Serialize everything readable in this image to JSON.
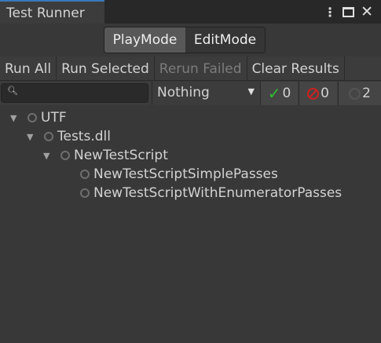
{
  "window": {
    "tab_title": "Test Runner",
    "menu_icon": "kebab-menu-icon",
    "maximize_icon": "maximize-icon",
    "close_icon": "close-icon"
  },
  "modes": {
    "play": "PlayMode",
    "edit": "EditMode",
    "selected": "PlayMode"
  },
  "toolbar": {
    "run_all": "Run All",
    "run_selected": "Run Selected",
    "rerun_failed": "Rerun Failed",
    "clear_results": "Clear Results"
  },
  "filter": {
    "search_value": "",
    "category": "Nothing",
    "passed": "0",
    "failed": "0",
    "not_run": "2"
  },
  "colors": {
    "accent": "#3a79bb",
    "passed": "#2fbf2f",
    "failed": "#d02020"
  },
  "tree": [
    {
      "label": "UTF",
      "depth": 0,
      "expanded": true
    },
    {
      "label": "Tests.dll",
      "depth": 1,
      "expanded": true
    },
    {
      "label": "NewTestScript",
      "depth": 2,
      "expanded": true
    },
    {
      "label": "NewTestScriptSimplePasses",
      "depth": 3
    },
    {
      "label": "NewTestScriptWithEnumeratorPasses",
      "depth": 3
    }
  ]
}
